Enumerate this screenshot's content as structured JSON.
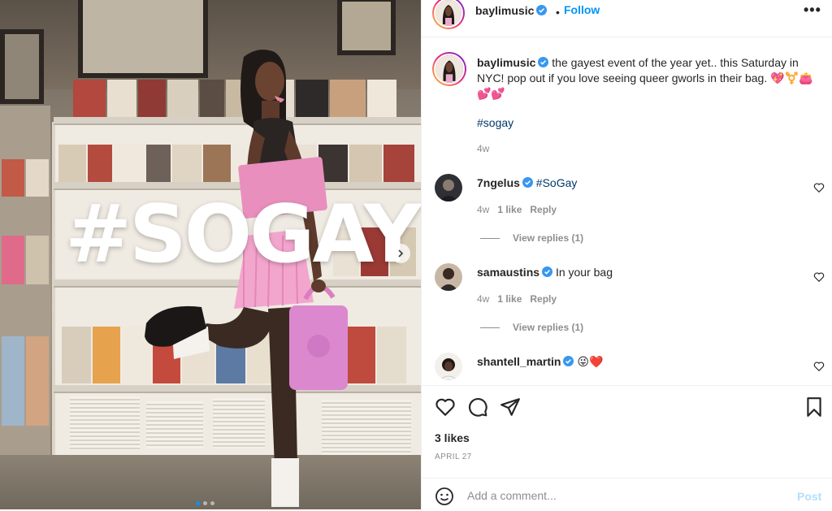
{
  "post_media": {
    "overlay_text": "#SOGAY",
    "carousel_dots": 3,
    "active_dot": 1
  },
  "header": {
    "username": "baylimusic",
    "separator": "•",
    "follow_label": "Follow",
    "more_label": "•••"
  },
  "caption": {
    "username": "baylimusic",
    "text": "the gayest event of the year yet.. this Saturday in NYC! pop out if you love seeing queer gworls in their bag. 💖⚧️👛💕💕",
    "hashtag": "#sogay",
    "age": "4w"
  },
  "comments": [
    {
      "username": "7ngelus",
      "text": "#SoGay",
      "age": "4w",
      "likes": "1 like",
      "reply_label": "Reply",
      "view_replies": "View replies (1)"
    },
    {
      "username": "samaustins",
      "text": "In your bag",
      "age": "4w",
      "likes": "1 like",
      "reply_label": "Reply",
      "view_replies": "View replies (1)"
    },
    {
      "username": "shantell_martin",
      "text": "😜❤️"
    }
  ],
  "footer": {
    "likes": "3 likes",
    "date": "APRIL 27",
    "comment_placeholder": "Add a comment...",
    "post_label": "Post"
  },
  "colors": {
    "accent": "#0095f6",
    "verified": "#3897f0",
    "post_disabled": "#b2dffc",
    "secondary_text": "#8e8e8e"
  },
  "icons": {
    "header_more": "more-dots-icon",
    "like": "heart-icon",
    "comment": "comment-bubble-icon",
    "share": "paper-plane-icon",
    "save": "bookmark-icon",
    "emoji": "emoji-icon",
    "next": "chevron-right-icon"
  }
}
